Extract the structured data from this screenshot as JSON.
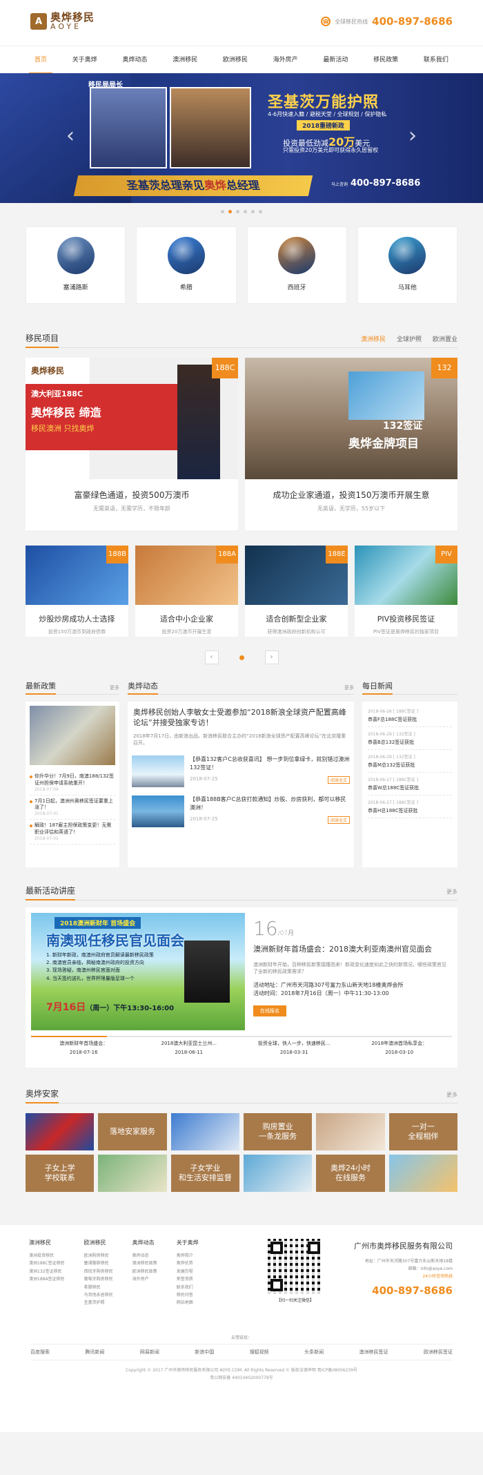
{
  "header": {
    "logo_cn": "奥烨移民",
    "logo_en": "AOYE",
    "hotline_label": "全球移民热线",
    "hotline_num": "400-897-8686"
  },
  "nav": [
    "首页",
    "关于奥烨",
    "奥烨动态",
    "澳洲移民",
    "欧洲移民",
    "海外房产",
    "最新活动",
    "移民政策",
    "联系我们"
  ],
  "banner": {
    "title1": "移民局局长",
    "main": "圣基茨万能护照",
    "sub": "4-6月快速入籍 / 避税天堂 / 全球规划 / 保护隐私",
    "tag": "2018重磅新政",
    "invest_pre": "投资最低劲减",
    "invest_amount": "20万",
    "invest_unit": "美元",
    "only": "只需投资20万美元即可获得永久居留权",
    "bottom_pre": "圣基茨总理亲见",
    "bottom_brand": "奥烨",
    "bottom_post": "总经理",
    "phone_label": "马上咨询",
    "phone": "400-897-8686"
  },
  "countries": [
    {
      "name": "塞浦路斯",
      "color": "#6a8fbf"
    },
    {
      "name": "希腊",
      "color": "#3a7fd5"
    },
    {
      "name": "西班牙",
      "color": "#c9843d"
    },
    {
      "name": "马耳他",
      "color": "#3b9fd1"
    }
  ],
  "projects": {
    "title": "移民项目",
    "tabs": [
      "澳洲移民",
      "全球护照",
      "欧洲置业"
    ],
    "big": [
      {
        "badge": "188C",
        "title": "富豪绿色通道，投资500万澳币",
        "sub": "无需英语，无需学历，不限年龄",
        "img_line1": "澳大利亚188C",
        "img_line2": "奥烨移民 缔造",
        "img_line3": "移民澳洲 只找奥烨"
      },
      {
        "badge": "132",
        "title": "成功企业家通道，投资150万澳币开展生意",
        "sub": "无英语，无学历，55岁以下",
        "img_line1": "132签证",
        "img_line2": "奥烨金牌项目",
        "img_line3": ""
      }
    ],
    "small": [
      {
        "badge": "188B",
        "title": "炒股炒房成功人士选择",
        "sub": "投资150万澳币到政府债券"
      },
      {
        "badge": "188A",
        "title": "适合中小企业家",
        "sub": "投资20万澳币开展生意"
      },
      {
        "badge": "188E",
        "title": "适合创新型企业家",
        "sub": "获得澳洲政府创新机构认可"
      },
      {
        "badge": "PIV",
        "title": "PIV投资移民签证",
        "sub": "PIV签证是奥烨移民的独家项目"
      }
    ]
  },
  "news": {
    "policy": {
      "title": "最新政策",
      "more": "更多",
      "items": [
        {
          "t": "你升华分！7月9日，南澳188/132签证州担保申请系统重开！",
          "d": "2018-07-09"
        },
        {
          "t": "7月1日起，澳洲州奥移民签证要重上涨了！",
          "d": "2018-07-01"
        },
        {
          "t": "解政！187雇主担保政策变更！无需职业评估和英语了！",
          "d": "2018-07-02"
        }
      ]
    },
    "trend": {
      "title": "奥烨动态",
      "more": "更多",
      "head": "奥烨移民创始人李敏女士受邀参加“2018新浪全球资产配置高峰论坛”并接受独家专访！",
      "desc": "2018年7月17日，由新浪出品、新浪移民联合主办的“2018新浪全球资产配置高峰论坛”在北京隆重召开。",
      "items": [
        {
          "t": "【恭喜132客户C总收获喜讯】 想一步到位拿绿卡，就别错过澳洲132签证！",
          "d": "2018-07-25",
          "btn": "阅读全文"
        },
        {
          "t": "【恭喜188B客户C总获打款通知】炒股、炒房获利，都可以移民澳洲！",
          "d": "2018-07-25",
          "btn": "阅读全文"
        }
      ]
    },
    "daily": {
      "title": "每日新闻",
      "items": [
        {
          "d": "2018-06-26",
          "tag": "[ 188C签证 ]",
          "t": "恭喜F总188C签证获批"
        },
        {
          "d": "2018-06-29",
          "tag": "[ 132签证 ]",
          "t": "恭喜B总132签证获批"
        },
        {
          "d": "2018-06-29",
          "tag": "[ 132签证 ]",
          "t": "恭喜M总132签证获批"
        },
        {
          "d": "2018-06-27",
          "tag": "[ 188C签证 ]",
          "t": "恭喜W总188C签证获批"
        },
        {
          "d": "2018-06-27",
          "tag": "[ 188C签证 ]",
          "t": "恭喜H总188C签证获批"
        }
      ]
    }
  },
  "events": {
    "title": "最新活动讲座",
    "more": "更多",
    "img_tag": "2018澳洲新财年 首场盛会",
    "img_main": "南澳现任移民官见面会",
    "img_lines": [
      "1. 新财年新政，南澳州政府官员解读最新移民政策",
      "2. 南澳官员亲临，揭秘南澳州政府的投资方向",
      "3. 现场答疑，南澳州移民官面对面",
      "4. 当天签约送礼，世界杯限量版足球一个"
    ],
    "img_date": "7月16日",
    "img_date_post": "（周一）下午13:30-16:00",
    "day": "16",
    "month": "07月",
    "ev_title": "澳洲新财年首场盛会：2018澳大利亚南澳州官见面会",
    "ev_desc": "澳洲新财年开始，百种移民新策接踵而来！新政变化速度如此之快的新情况，哪些政策官见了全新的移民政策需求？",
    "ev_place": "活动地址：广州市天河路307号富力东山新天地18楼奥烨会所",
    "ev_time": "活动时间：2018年7月16日（周一）中午11:30-13:00",
    "ev_btn": "在线报名",
    "list": [
      {
        "a": "澳洲新财年首场盛会：",
        "b": "2018-07-16"
      },
      {
        "a": "2018澳大利亚昆士兰州...",
        "b": "2018-06-11"
      },
      {
        "a": "投资全球，快人一步，快速移民...",
        "b": "2018-03-31"
      },
      {
        "a": "2018年澳洲首场私享会：",
        "b": "2018-03-10"
      }
    ]
  },
  "home": {
    "title": "奥烨安家",
    "more": "更多",
    "tiles": [
      {
        "type": "img"
      },
      {
        "type": "txt",
        "t": "落地安家服务"
      },
      {
        "type": "img"
      },
      {
        "type": "txt",
        "t": "购房置业\n一条龙服务"
      },
      {
        "type": "img"
      },
      {
        "type": "txt",
        "t": "一对一\n全程相伴"
      },
      {
        "type": "txt",
        "t": "子女上学\n学校联系"
      },
      {
        "type": "img"
      },
      {
        "type": "txt",
        "t": "子女学业\n和生活安排监督"
      },
      {
        "type": "img"
      },
      {
        "type": "txt",
        "t": "奥烨24小时\n在线服务"
      },
      {
        "type": "img"
      }
    ]
  },
  "footer": {
    "cols": [
      {
        "h": "澳洲移民",
        "l": [
          "澳洲投资移民",
          "澳洲188C签证移民",
          "澳洲132签证移民",
          "澳洲188A签证移民"
        ]
      },
      {
        "h": "欧洲移民",
        "l": [
          "欧洲购房移民",
          "塞浦路斯移民",
          "西班牙购房移民",
          "葡萄牙购房移民",
          "希腊移民",
          "马耳他永居移民",
          "圣基茨护照"
        ]
      },
      {
        "h": "奥烨动态",
        "l": [
          "奥烨动态",
          "澳洲移民政策",
          "欧洲移民政策",
          "海外房产"
        ]
      },
      {
        "h": "关于奥烨",
        "l": [
          "奥烨简介",
          "奥烨优势",
          "发展历程",
          "荣誉资质",
          "联系我们",
          "移民问答",
          "网站地图"
        ]
      }
    ],
    "qr_cap": "【扫一扫关注微信】",
    "company": "广州市奥烨移民服务有限公司",
    "address": "地址：广州市天河路307号富力东山新天地18楼",
    "email": "邮箱：info@aoye.com",
    "online": "24小时咨询热线",
    "phone": "400-897-8686",
    "links_title": "友情链接：",
    "links": [
      "百度搜索",
      "腾讯新闻",
      "网易新闻",
      "新浪中国",
      "搜狐视频",
      "头条新闻",
      "澳洲移民签证",
      "欧洲移民签证"
    ],
    "copy1": "Copyright © 2017 广州市奥烨移民服务有限公司 AOYE.COM. All Rights Reserved © 版权法律声明  粤ICP备08006239号",
    "copy2": "粤公网安备 44010402000778号"
  }
}
